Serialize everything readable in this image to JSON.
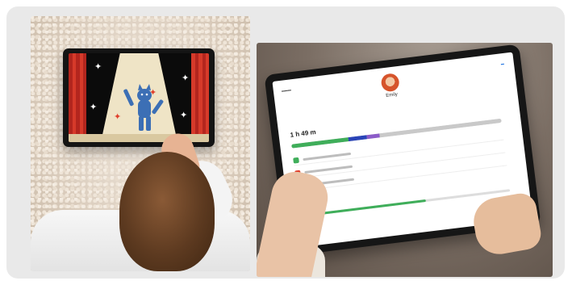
{
  "left_photo": {
    "scene": "child-touching-tablet-with-stage-animation"
  },
  "right_photo": {
    "scene": "hands-holding-tablet-with-screen-time-app",
    "screen": {
      "profile_name": "Emily",
      "total_time": "1 h 49 m",
      "usage_segments": [
        {
          "color": "#3fae5a",
          "share": 0.27
        },
        {
          "color": "#2a44b8",
          "share": 0.09
        },
        {
          "color": "#8c5cc9",
          "share": 0.06
        },
        {
          "color": "#c9c9c9",
          "share": 0.58
        }
      ],
      "app_icon_colors": [
        "#3fae5a",
        "#e0402c",
        "#c2362b"
      ]
    }
  },
  "colors": {
    "frame_background": "#e9e9e9",
    "curtain_red": "#d63a2a",
    "accent_blue": "#2a7ae2",
    "usage_green": "#3fae5a"
  }
}
